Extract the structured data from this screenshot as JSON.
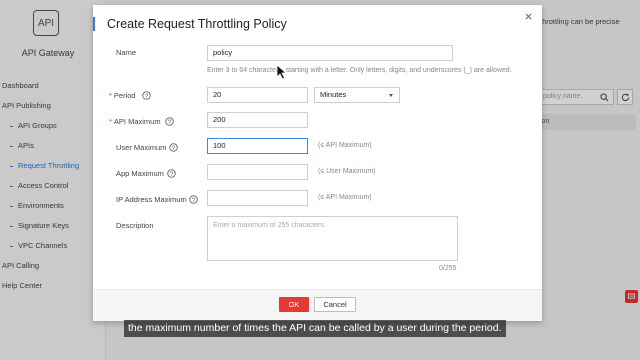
{
  "sidebar": {
    "logo_text": "API",
    "app_name": "API Gateway",
    "items": [
      {
        "label": "Dashboard"
      },
      {
        "label": "API Publishing"
      },
      {
        "label": "API Groups"
      },
      {
        "label": "APIs"
      },
      {
        "label": "Request Throttling"
      },
      {
        "label": "Access Control"
      },
      {
        "label": "Environments"
      },
      {
        "label": "Signature Keys"
      },
      {
        "label": "VPC Channels"
      },
      {
        "label": "API Calling"
      },
      {
        "label": "Help Center"
      }
    ]
  },
  "background": {
    "info_text": "throttling can be precise",
    "search_placeholder": "policy name.",
    "table_header": "ion"
  },
  "dialog": {
    "title": "Create Request Throttling Policy",
    "fields": {
      "name": {
        "label": "Name",
        "value": "policy",
        "hint": "Enter 3 to 64 characters, starting with a letter. Only letters, digits, and underscores (_) are allowed."
      },
      "period": {
        "label": "Period",
        "value": "20",
        "unit": "Minutes"
      },
      "api_max": {
        "label": "API Maximum",
        "value": "200"
      },
      "user_max": {
        "label": "User Maximum",
        "value": "100",
        "hint": "(≤ API Maximum)"
      },
      "app_max": {
        "label": "App Maximum",
        "value": "",
        "hint": "(≤ User Maximum)"
      },
      "ip_max": {
        "label": "IP Address Maximum",
        "value": "",
        "hint": "(≤ API Maximum)"
      },
      "description": {
        "label": "Description",
        "placeholder": "Enter a maximum of 255 characters.",
        "counter": "0/255"
      }
    },
    "ok_label": "OK",
    "cancel_label": "Cancel"
  },
  "caption": "the maximum number of times the API can be called by a user during the period.",
  "colors": {
    "accent": "#2e7cd6",
    "primary_button": "#e53935",
    "required": "#e53935"
  }
}
